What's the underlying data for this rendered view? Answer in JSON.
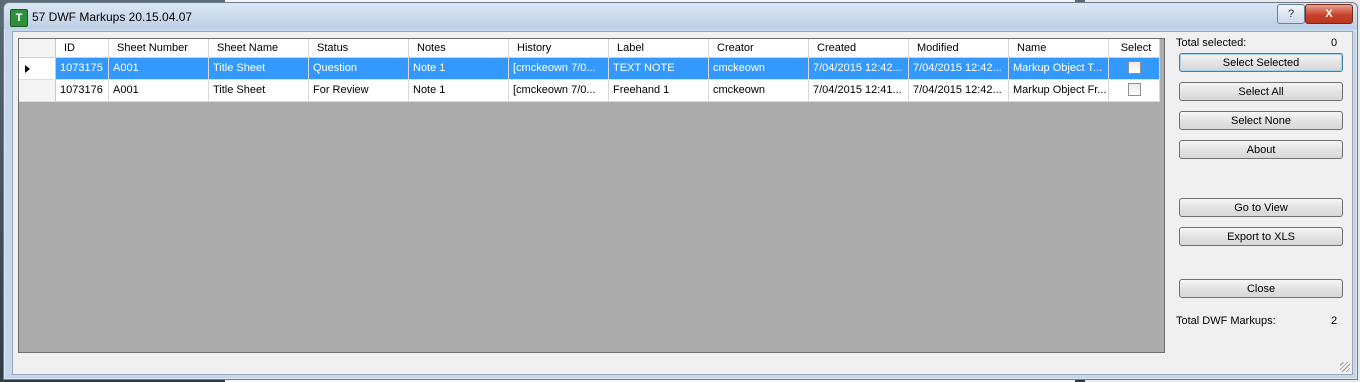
{
  "window": {
    "title": "57 DWF Markups 20.15.04.07",
    "help_label": "?",
    "close_label": "X"
  },
  "grid": {
    "columns": [
      "ID",
      "Sheet Number",
      "Sheet Name",
      "Status",
      "Notes",
      "History",
      "Label",
      "Creator",
      "Created",
      "Modified",
      "Name",
      "Select"
    ],
    "rows": [
      {
        "id": "1073175",
        "sheet_number": "A001",
        "sheet_name": "Title Sheet",
        "status": "Question",
        "notes": "Note 1",
        "history": "[cmckeown  7/0...",
        "label": "TEXT NOTE",
        "creator": "cmckeown",
        "created": "7/04/2015 12:42...",
        "modified": "7/04/2015 12:42...",
        "name": "Markup Object T...",
        "selected": false
      },
      {
        "id": "1073176",
        "sheet_number": "A001",
        "sheet_name": "Title Sheet",
        "status": "For Review",
        "notes": "Note 1",
        "history": "[cmckeown  7/0...",
        "label": "Freehand 1",
        "creator": "cmckeown",
        "created": "7/04/2015 12:41...",
        "modified": "7/04/2015 12:42...",
        "name": "Markup Object Fr...",
        "selected": false
      }
    ]
  },
  "side": {
    "total_selected_label": "Total selected:",
    "total_selected_value": "0",
    "buttons": {
      "select_selected": "Select Selected",
      "select_all": "Select All",
      "select_none": "Select None",
      "about": "About",
      "go_to_view": "Go to View",
      "export_xls": "Export to XLS",
      "close": "Close"
    },
    "total_markups_label": "Total DWF Markups:",
    "total_markups_value": "2"
  },
  "colors": {
    "selection": "#3399ff",
    "grid_background": "#ababab"
  }
}
